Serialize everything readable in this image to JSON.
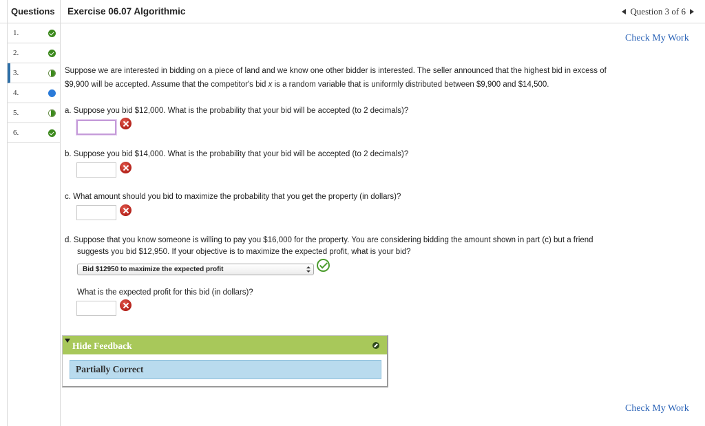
{
  "header": {
    "questions_label": "Questions",
    "exercise_title": "Exercise 06.07 Algorithmic",
    "question_position": "Question 3 of 6"
  },
  "sidebar": {
    "items": [
      {
        "label": "1.",
        "status": "correct"
      },
      {
        "label": "2.",
        "status": "correct"
      },
      {
        "label": "3.",
        "status": "partial"
      },
      {
        "label": "4.",
        "status": "current"
      },
      {
        "label": "5.",
        "status": "partial"
      },
      {
        "label": "6.",
        "status": "correct"
      }
    ]
  },
  "main": {
    "check_my_work": "Check My Work",
    "intro_line1": "Suppose we are interested in bidding on a piece of land and we know one other bidder is interested. The seller announced that the highest bid in excess of",
    "intro_line2_pre": "$9,900 will be accepted. Assume that the competitor's bid ",
    "intro_var": "x",
    "intro_line2_post": " is a random variable that is uniformly distributed between $9,900 and $14,500.",
    "part_a": "a.  Suppose you bid $12,000. What is the probability that your bid will be accepted (to 2 decimals)?",
    "part_b": "b.  Suppose you bid $14,000. What is the probability that your bid will be accepted (to 2 decimals)?",
    "part_c": "c.  What amount should you bid to maximize the probability that you get the property (in dollars)?",
    "part_d_line1": "d.  Suppose that you know someone is willing to pay you $16,000 for the property. You are considering bidding the amount shown in part (c) but a friend",
    "part_d_line2": "suggests you bid $12,950. If your objective is to maximize the expected profit, what is your bid?",
    "part_d_select": "Bid $12950 to maximize the expected profit",
    "expected_profit_q": "What is the expected profit for this bid (in dollars)?",
    "inputs": {
      "a": "",
      "b": "",
      "c": "",
      "profit": ""
    }
  },
  "feedback": {
    "toggle_label": "Hide Feedback",
    "result": "Partially Correct"
  },
  "colors": {
    "link": "#2760b5",
    "feedback_header": "#a8c85a",
    "feedback_body": "#b9dbee",
    "correct": "#3d8a1e",
    "incorrect": "#c0281e",
    "current": "#2a7ad9"
  }
}
